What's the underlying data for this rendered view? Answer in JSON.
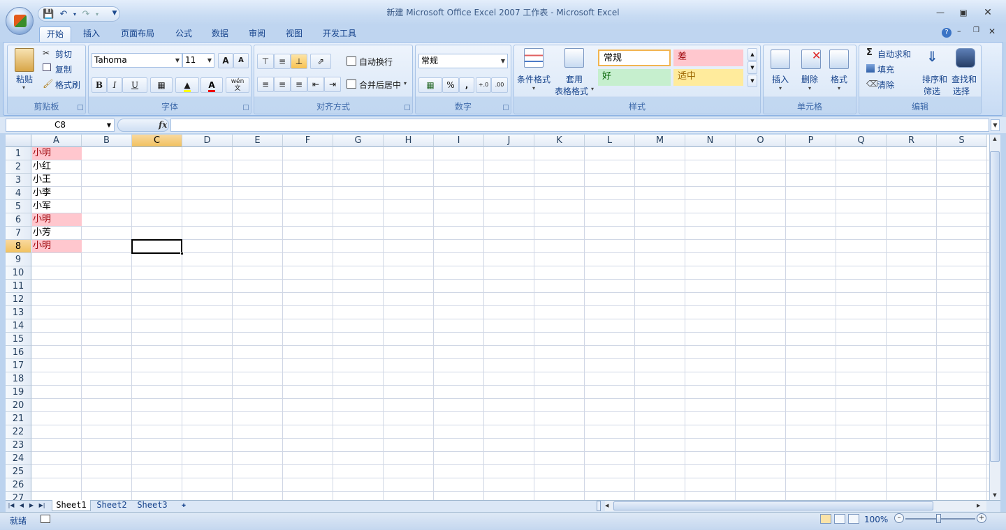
{
  "title": "新建 Microsoft Office Excel 2007 工作表 - Microsoft Excel",
  "qat": {
    "icons": [
      "save-icon",
      "undo-icon",
      "redo-icon",
      "customize-icon"
    ]
  },
  "tabs": [
    "开始",
    "插入",
    "页面布局",
    "公式",
    "数据",
    "审阅",
    "视图",
    "开发工具"
  ],
  "active_tab": "开始",
  "ribbon": {
    "clipboard": {
      "label": "剪贴板",
      "paste": "粘贴",
      "cut": "剪切",
      "copy": "复制",
      "format_painter": "格式刷"
    },
    "font": {
      "label": "字体",
      "font_name": "Tahoma",
      "font_size": "11",
      "bold": "B",
      "italic": "I",
      "underline": "U",
      "grow": "A",
      "shrink": "A",
      "color_a": "A",
      "wen": "wén",
      "wen2": "文"
    },
    "alignment": {
      "label": "对齐方式",
      "wrap": "自动换行",
      "merge": "合并后居中"
    },
    "number": {
      "label": "数字",
      "format": "常规",
      "percent": "%",
      "comma": ",",
      "inc": "+.0",
      "dec": ".00"
    },
    "styles": {
      "label": "样式",
      "cond_format": "条件格式",
      "table_format_1": "套用",
      "table_format_2": "表格格式",
      "normal": "常规",
      "bad": "差",
      "good": "好",
      "neutral": "适中"
    },
    "cells": {
      "label": "单元格",
      "insert": "插入",
      "delete": "删除",
      "format": "格式"
    },
    "editing": {
      "label": "编辑",
      "autosum": "自动求和",
      "fill": "填充",
      "clear": "清除",
      "sort_1": "排序和",
      "sort_2": "筛选",
      "find_1": "查找和",
      "find_2": "选择",
      "sigma": "Σ"
    }
  },
  "namebox": "C8",
  "fx": "fx",
  "columns": [
    "A",
    "B",
    "C",
    "D",
    "E",
    "F",
    "G",
    "H",
    "I",
    "J",
    "K",
    "L",
    "M",
    "N",
    "O",
    "P",
    "Q",
    "R",
    "S"
  ],
  "selected_column": "C",
  "rows": [
    "1",
    "2",
    "3",
    "4",
    "5",
    "6",
    "7",
    "8",
    "9",
    "10",
    "11",
    "12",
    "13",
    "14",
    "15",
    "16",
    "17",
    "18",
    "19",
    "20",
    "21",
    "22",
    "23",
    "24",
    "25",
    "26",
    "27"
  ],
  "selected_row": "8",
  "cells_a": [
    {
      "row": "1",
      "value": "小明",
      "highlight": true
    },
    {
      "row": "2",
      "value": "小红",
      "highlight": false
    },
    {
      "row": "3",
      "value": "小王",
      "highlight": false
    },
    {
      "row": "4",
      "value": "小李",
      "highlight": false
    },
    {
      "row": "5",
      "value": "小军",
      "highlight": false
    },
    {
      "row": "6",
      "value": "小明",
      "highlight": true
    },
    {
      "row": "7",
      "value": "小芳",
      "highlight": false
    },
    {
      "row": "8",
      "value": "小明",
      "highlight": true
    }
  ],
  "highlight_colors": {
    "fill": "#ffc7ce",
    "text": "#9c0006"
  },
  "sheets": [
    "Sheet1",
    "Sheet2",
    "Sheet3"
  ],
  "active_sheet": "Sheet1",
  "status": {
    "ready": "就绪",
    "zoom": "100%"
  }
}
